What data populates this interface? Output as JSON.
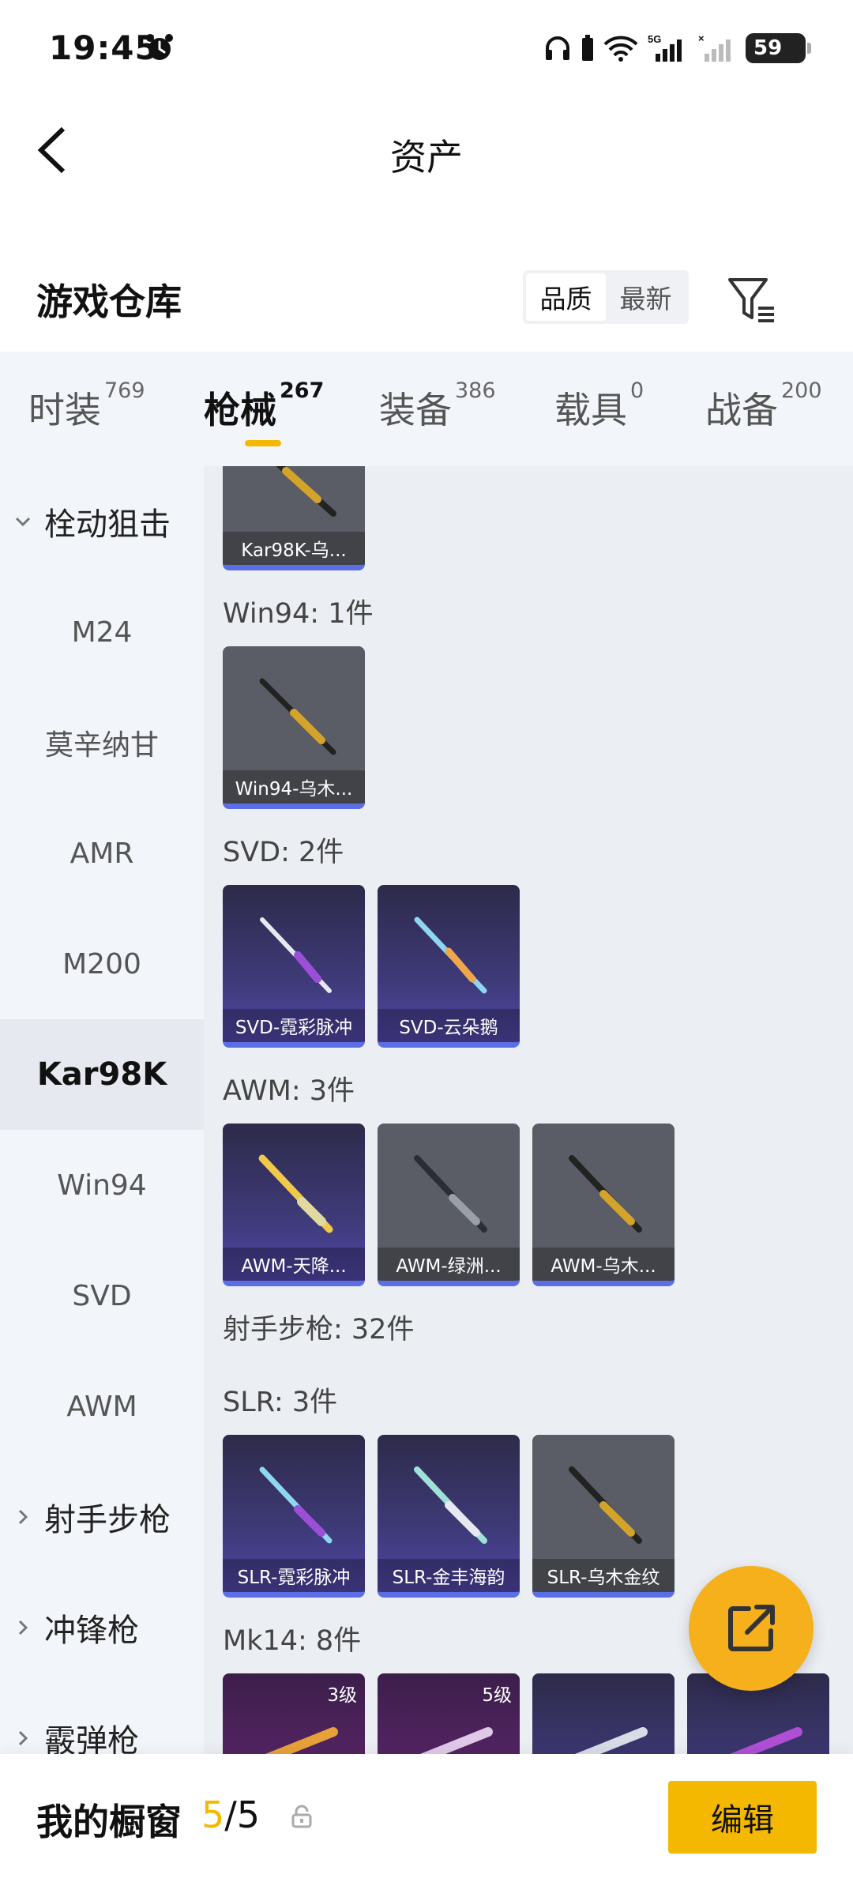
{
  "status_bar": {
    "time": "19:45",
    "battery": "59"
  },
  "nav": {
    "title": "资产"
  },
  "header": {
    "title": "游戏仓库",
    "sort_options": [
      "品质",
      "最新"
    ],
    "sort_active": "品质"
  },
  "tabs": [
    {
      "label": "时装",
      "count": "769"
    },
    {
      "label": "枪械",
      "count": "267",
      "active": true
    },
    {
      "label": "装备",
      "count": "386"
    },
    {
      "label": "载具",
      "count": "0"
    },
    {
      "label": "战备",
      "count": "200"
    }
  ],
  "sidebar": {
    "items": [
      {
        "label": "栓动狙击",
        "type": "group",
        "expanded": true
      },
      {
        "label": "M24"
      },
      {
        "label": "莫辛纳甘"
      },
      {
        "label": "AMR"
      },
      {
        "label": "M200"
      },
      {
        "label": "Kar98K",
        "active": true
      },
      {
        "label": "Win94"
      },
      {
        "label": "SVD"
      },
      {
        "label": "AWM"
      },
      {
        "label": "射手步枪",
        "type": "group"
      },
      {
        "label": "冲锋枪",
        "type": "group"
      },
      {
        "label": "霰弹枪",
        "type": "group"
      }
    ]
  },
  "content": {
    "groups": [
      {
        "label": "Win94: 1件"
      },
      {
        "label": "SVD: 2件"
      },
      {
        "label": "AWM: 3件"
      },
      {
        "label": "射手步枪: 32件"
      },
      {
        "label": "SLR: 3件"
      },
      {
        "label": "Mk14: 8件"
      }
    ],
    "cards": [
      {
        "name": "Kar98K-乌...",
        "style": "gray"
      },
      {
        "name": "Win94-乌木...",
        "style": "gray"
      },
      {
        "name": "SVD-霓彩脉冲",
        "style": "purple"
      },
      {
        "name": "SVD-云朵鹅",
        "style": "purple"
      },
      {
        "name": "AWM-天降...",
        "style": "purple"
      },
      {
        "name": "AWM-绿洲...",
        "style": "gray"
      },
      {
        "name": "AWM-乌木...",
        "style": "gray"
      },
      {
        "name": "SLR-霓彩脉冲",
        "style": "purple"
      },
      {
        "name": "SLR-金丰海韵",
        "style": "purple"
      },
      {
        "name": "SLR-乌木金纹",
        "style": "gray"
      },
      {
        "grade": "3级",
        "style": "violet"
      },
      {
        "grade": "5级",
        "style": "violet"
      },
      {
        "style": "purple"
      },
      {
        "style": "purple"
      }
    ]
  },
  "showcase": {
    "label": "我的橱窗",
    "current": "5",
    "separator": "/",
    "total": "5",
    "edit_label": "编辑"
  },
  "colors": {
    "accent": "#f5b800",
    "fab": "#f5b01c",
    "sidebar_bg": "#f2f5f9",
    "content_bg": "#ebeef3",
    "rarity_blue": "#5b6ee6"
  }
}
